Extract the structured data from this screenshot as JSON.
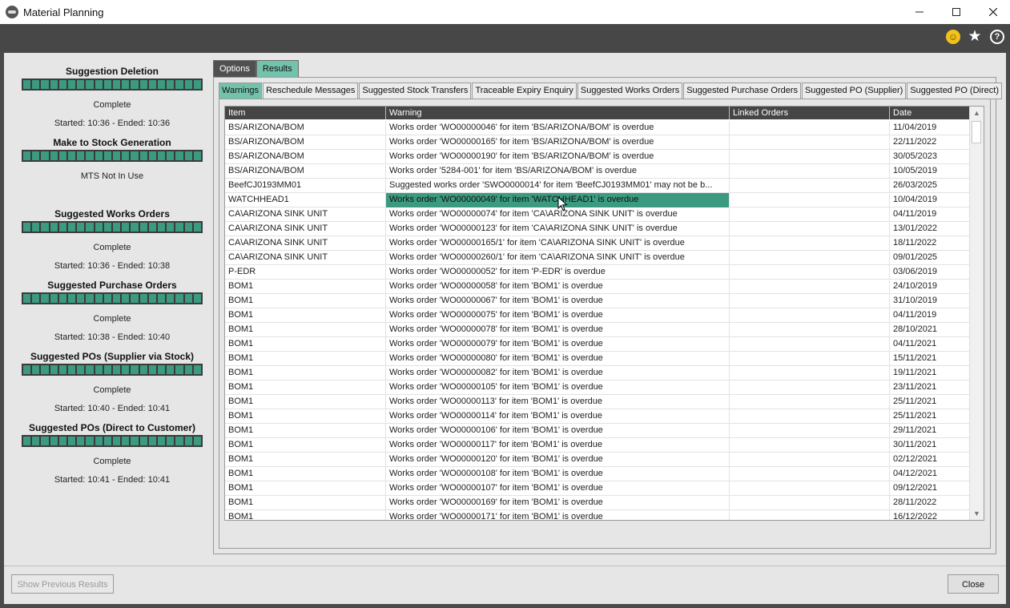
{
  "window": {
    "title": "Material Planning",
    "minimize": "—",
    "maximize": "☐",
    "close": "✕"
  },
  "toolbar": {
    "smiley": "☺",
    "star": "★",
    "help": "?"
  },
  "sections": [
    {
      "title": "Suggestion Deletion",
      "status": "Complete",
      "time": "Started: 10:36 - Ended: 10:36",
      "progress": 1.0
    },
    {
      "title": "Make to Stock Generation",
      "status": "MTS Not In Use",
      "time": "",
      "progress": 1.0
    },
    {
      "title": "Suggested Works Orders",
      "status": "Complete",
      "time": "Started: 10:36 - Ended: 10:38",
      "progress": 1.0
    },
    {
      "title": "Suggested Purchase Orders",
      "status": "Complete",
      "time": "Started: 10:38 - Ended: 10:40",
      "progress": 1.0
    },
    {
      "title": "Suggested POs (Supplier via Stock)",
      "status": "Complete",
      "time": "Started: 10:40 - Ended: 10:41",
      "progress": 1.0
    },
    {
      "title": "Suggested POs (Direct to Customer)",
      "status": "Complete",
      "time": "Started: 10:41 - Ended: 10:41",
      "progress": 1.0
    }
  ],
  "outer_tabs": [
    {
      "label": "Options",
      "active": false
    },
    {
      "label": "Results",
      "active": true
    }
  ],
  "inner_tabs": [
    {
      "label": "Warnings",
      "active": true
    },
    {
      "label": "Reschedule Messages",
      "active": false
    },
    {
      "label": "Suggested Stock Transfers",
      "active": false
    },
    {
      "label": "Traceable Expiry Enquiry",
      "active": false
    },
    {
      "label": "Suggested Works Orders",
      "active": false
    },
    {
      "label": "Suggested Purchase Orders",
      "active": false
    },
    {
      "label": "Suggested PO (Supplier)",
      "active": false
    },
    {
      "label": "Suggested PO (Direct)",
      "active": false
    }
  ],
  "grid": {
    "columns": [
      "Item",
      "Warning",
      "Linked Orders",
      "Date"
    ],
    "rows": [
      {
        "item": "BS/ARIZONA/BOM",
        "warning": "Works order 'WO00000046' for item 'BS/ARIZONA/BOM' is overdue",
        "linked": "",
        "date": "11/04/2019"
      },
      {
        "item": "BS/ARIZONA/BOM",
        "warning": "Works order 'WO00000165' for item 'BS/ARIZONA/BOM' is overdue",
        "linked": "",
        "date": "22/11/2022"
      },
      {
        "item": "BS/ARIZONA/BOM",
        "warning": "Works order 'WO00000190' for item 'BS/ARIZONA/BOM' is overdue",
        "linked": "",
        "date": "30/05/2023"
      },
      {
        "item": "BS/ARIZONA/BOM",
        "warning": "Works order '5284-001' for item 'BS/ARIZONA/BOM' is overdue",
        "linked": "",
        "date": "10/05/2019"
      },
      {
        "item": "BeefCJ0193MM01",
        "warning": "Suggested works order 'SWO0000014' for item 'BeefCJ0193MM01' may not be b...",
        "linked": "",
        "date": "26/03/2025"
      },
      {
        "item": "WATCHHEAD1",
        "warning": "Works order 'WO00000049' for item 'WATCHHEAD1' is overdue",
        "linked": "",
        "date": "10/04/2019",
        "selected": true
      },
      {
        "item": "CA\\ARIZONA SINK UNIT",
        "warning": "Works order 'WO00000074' for item 'CA\\ARIZONA SINK UNIT' is overdue",
        "linked": "",
        "date": "04/11/2019"
      },
      {
        "item": "CA\\ARIZONA SINK UNIT",
        "warning": "Works order 'WO00000123' for item 'CA\\ARIZONA SINK UNIT' is overdue",
        "linked": "",
        "date": "13/01/2022"
      },
      {
        "item": "CA\\ARIZONA SINK UNIT",
        "warning": "Works order 'WO00000165/1' for item 'CA\\ARIZONA SINK UNIT' is overdue",
        "linked": "",
        "date": "18/11/2022"
      },
      {
        "item": "CA\\ARIZONA SINK UNIT",
        "warning": "Works order 'WO00000260/1' for item 'CA\\ARIZONA SINK UNIT' is overdue",
        "linked": "",
        "date": "09/01/2025"
      },
      {
        "item": "P-EDR",
        "warning": "Works order 'WO00000052' for item 'P-EDR' is overdue",
        "linked": "",
        "date": "03/06/2019"
      },
      {
        "item": "BOM1",
        "warning": "Works order 'WO00000058' for item 'BOM1' is overdue",
        "linked": "",
        "date": "24/10/2019"
      },
      {
        "item": "BOM1",
        "warning": "Works order 'WO00000067' for item 'BOM1' is overdue",
        "linked": "",
        "date": "31/10/2019"
      },
      {
        "item": "BOM1",
        "warning": "Works order 'WO00000075' for item 'BOM1' is overdue",
        "linked": "",
        "date": "04/11/2019"
      },
      {
        "item": "BOM1",
        "warning": "Works order 'WO00000078' for item 'BOM1' is overdue",
        "linked": "",
        "date": "28/10/2021"
      },
      {
        "item": "BOM1",
        "warning": "Works order 'WO00000079' for item 'BOM1' is overdue",
        "linked": "",
        "date": "04/11/2021"
      },
      {
        "item": "BOM1",
        "warning": "Works order 'WO00000080' for item 'BOM1' is overdue",
        "linked": "",
        "date": "15/11/2021"
      },
      {
        "item": "BOM1",
        "warning": "Works order 'WO00000082' for item 'BOM1' is overdue",
        "linked": "",
        "date": "19/11/2021"
      },
      {
        "item": "BOM1",
        "warning": "Works order 'WO00000105' for item 'BOM1' is overdue",
        "linked": "",
        "date": "23/11/2021"
      },
      {
        "item": "BOM1",
        "warning": "Works order 'WO00000113' for item 'BOM1' is overdue",
        "linked": "",
        "date": "25/11/2021"
      },
      {
        "item": "BOM1",
        "warning": "Works order 'WO00000114' for item 'BOM1' is overdue",
        "linked": "",
        "date": "25/11/2021"
      },
      {
        "item": "BOM1",
        "warning": "Works order 'WO00000106' for item 'BOM1' is overdue",
        "linked": "",
        "date": "29/11/2021"
      },
      {
        "item": "BOM1",
        "warning": "Works order 'WO00000117' for item 'BOM1' is overdue",
        "linked": "",
        "date": "30/11/2021"
      },
      {
        "item": "BOM1",
        "warning": "Works order 'WO00000120' for item 'BOM1' is overdue",
        "linked": "",
        "date": "02/12/2021"
      },
      {
        "item": "BOM1",
        "warning": "Works order 'WO00000108' for item 'BOM1' is overdue",
        "linked": "",
        "date": "04/12/2021"
      },
      {
        "item": "BOM1",
        "warning": "Works order 'WO00000107' for item 'BOM1' is overdue",
        "linked": "",
        "date": "09/12/2021"
      },
      {
        "item": "BOM1",
        "warning": "Works order 'WO00000169' for item 'BOM1' is overdue",
        "linked": "",
        "date": "28/11/2022"
      },
      {
        "item": "BOM1",
        "warning": "Works order 'WO00000171' for item 'BOM1' is overdue",
        "linked": "",
        "date": "16/12/2022"
      }
    ]
  },
  "footer": {
    "show_previous": "Show Previous Results",
    "close": "Close"
  },
  "colors": {
    "accent": "#73c2ac",
    "selection": "#3b9a80",
    "progress": "#3b9a80",
    "dark": "#474747"
  }
}
